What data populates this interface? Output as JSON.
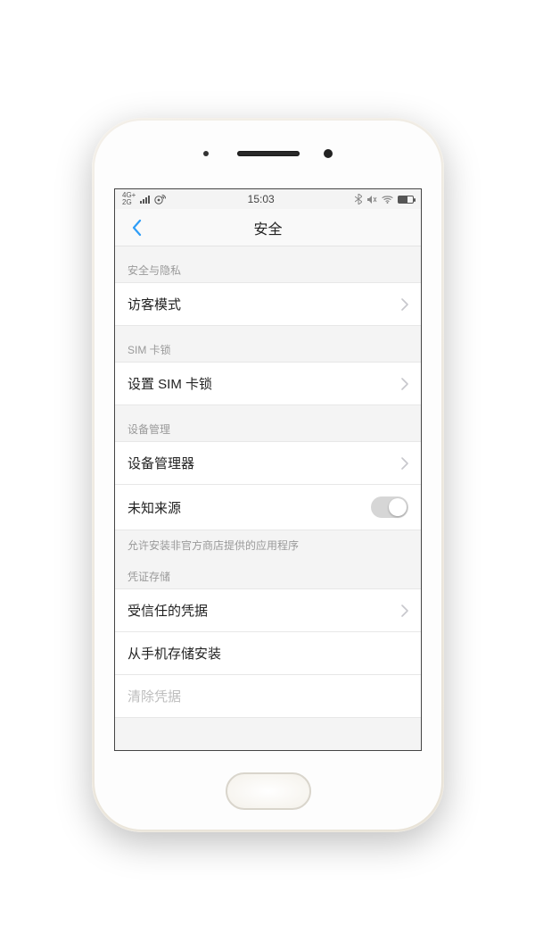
{
  "statusbar": {
    "signal_top": "4G+",
    "signal_bottom": "2G",
    "time": "15:03"
  },
  "header": {
    "title": "安全"
  },
  "sections": {
    "privacy": {
      "label": "安全与隐私",
      "guest_mode": "访客模式"
    },
    "sim": {
      "label": "SIM 卡锁",
      "set_sim_lock": "设置 SIM 卡锁"
    },
    "device": {
      "label": "设备管理",
      "device_admin": "设备管理器",
      "unknown_sources": "未知来源",
      "unknown_sources_on": false,
      "unknown_sources_desc": "允许安装非官方商店提供的应用程序"
    },
    "cred": {
      "label": "凭证存储",
      "trusted": "受信任的凭据",
      "install": "从手机存储安装",
      "clear": "清除凭据"
    }
  }
}
